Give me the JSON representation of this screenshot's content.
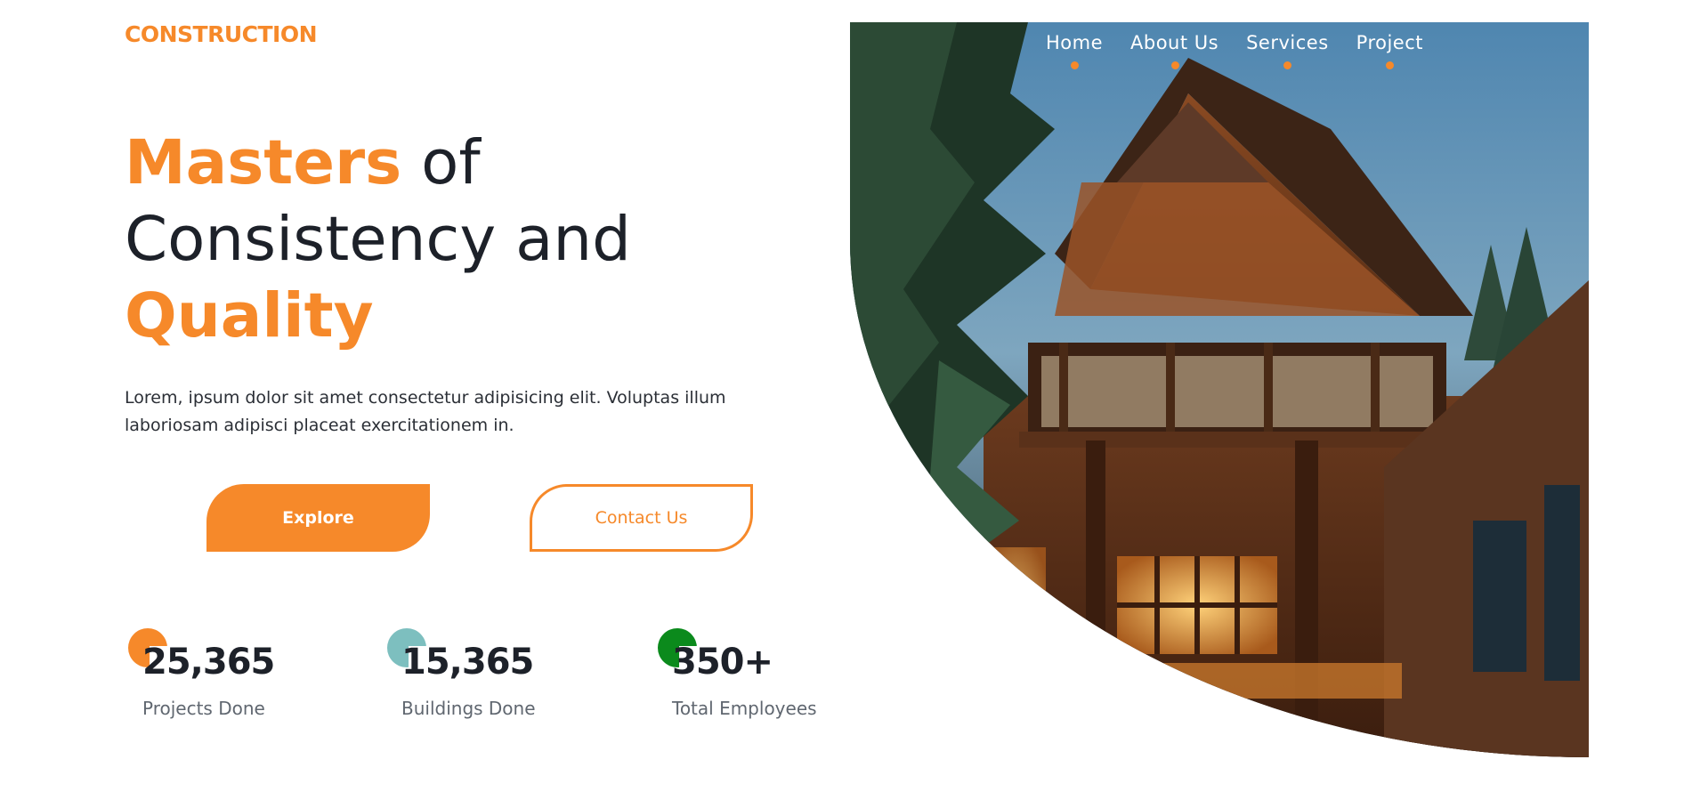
{
  "brand": {
    "logo": "CONSTRUCTION"
  },
  "nav": {
    "items": [
      {
        "label": "Home"
      },
      {
        "label": "About Us"
      },
      {
        "label": "Services"
      },
      {
        "label": "Project"
      }
    ]
  },
  "hero": {
    "headline_1": "Masters",
    "headline_2": " of",
    "headline_3": "Consistency and",
    "headline_4": "Quality",
    "lede": "Lorem, ipsum dolor sit amet consectetur adipisicing elit. Voluptas illum laboriosam adipisci placeat exercitationem in.",
    "explore_label": "Explore",
    "contact_label": "Contact Us"
  },
  "stats": [
    {
      "value": "25,365",
      "label": "Projects Done",
      "color": "#f6892a"
    },
    {
      "value": "15,365",
      "label": "Buildings Done",
      "color": "#7dbfbf"
    },
    {
      "value": "350+",
      "label": "Total Employees",
      "color": "#0b8a1c"
    }
  ],
  "colors": {
    "accent": "#f6892a",
    "text": "#1d2129",
    "muted": "#606770"
  }
}
